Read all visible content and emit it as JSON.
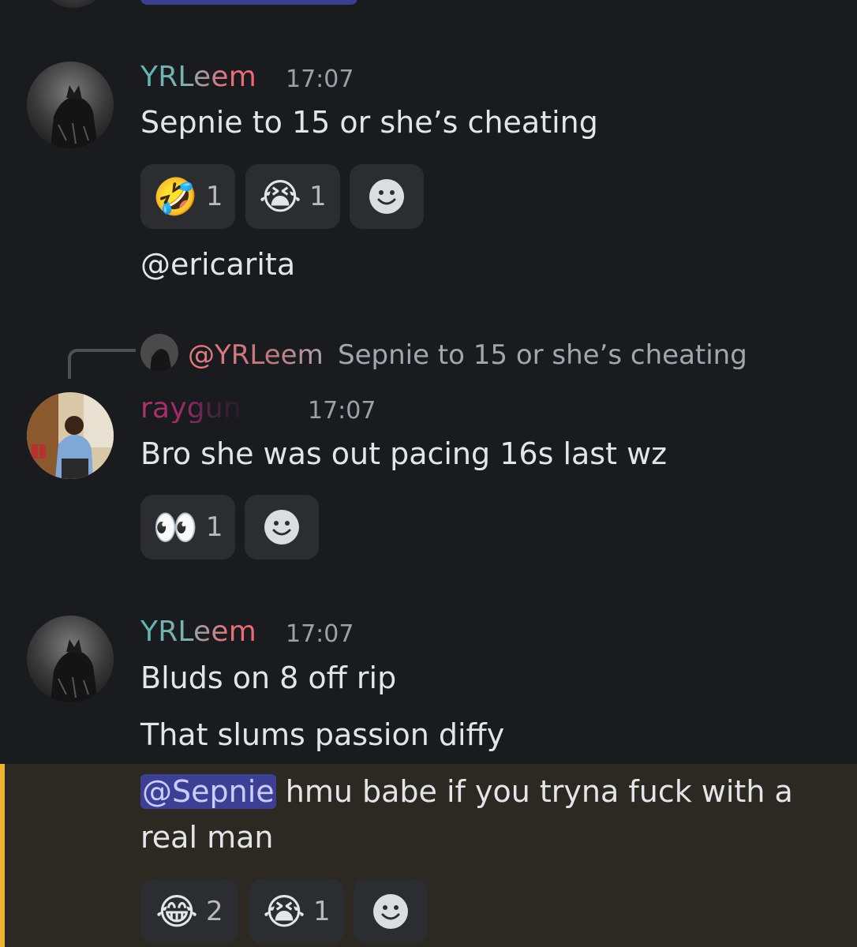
{
  "messages": [
    {
      "author": "YRLeem",
      "time": "17:07",
      "lines": [
        "Sepnie to 15 or she’s cheating"
      ],
      "reactions": [
        {
          "emoji": "🤣",
          "count": "1"
        },
        {
          "emoji": "😭",
          "count": "1"
        }
      ],
      "followup": "@ericarita"
    },
    {
      "reply_to": {
        "mention": "@YRLeem",
        "text": "Sepnie to 15 or she’s cheating"
      },
      "author": "raygun",
      "time": "17:07",
      "lines": [
        "Bro she was out pacing 16s last wz"
      ],
      "reactions": [
        {
          "emoji": "👀",
          "count": "1"
        }
      ]
    },
    {
      "author": "YRLeem",
      "time": "17:07",
      "lines": [
        "Bluds on 8 off rip",
        "That slums passion diffy"
      ],
      "highlight_message": {
        "mention": "@Sepnie",
        "text_line1": " hmu babe if you tryna fuck with a",
        "text_line2": "real man"
      },
      "reactions": [
        {
          "emoji": "😂",
          "count": "2"
        },
        {
          "emoji": "😭",
          "count": "1"
        }
      ]
    }
  ],
  "colors": {
    "background": "#1a1b1e",
    "reaction_bg": "#2b2d31",
    "mention_bg": "#3c3f94",
    "highlight_bar": "#f0b232"
  },
  "icons": {
    "add_reaction": "smiley-add-icon"
  }
}
